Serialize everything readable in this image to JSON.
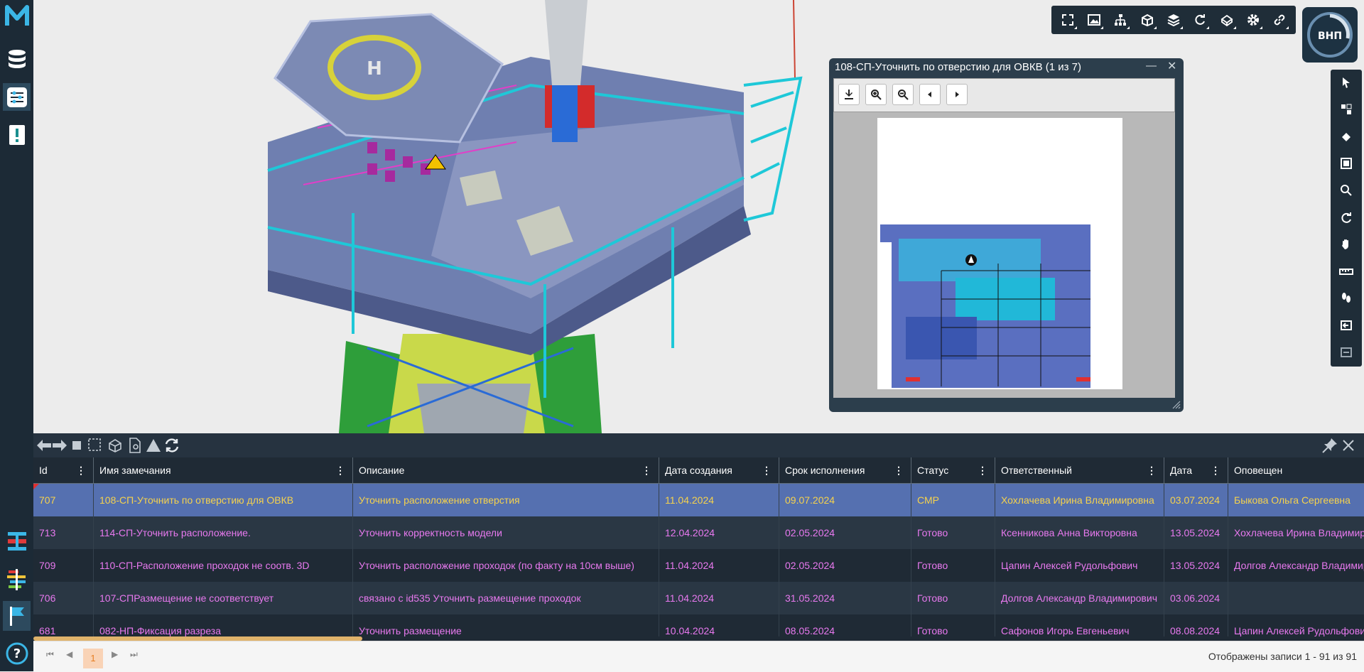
{
  "doc_window": {
    "title": "108-СП-Уточнить по отверстию для ОВКВ (1 из 7)",
    "minimize_symbol": "—",
    "close_symbol": "✕"
  },
  "logo": {
    "text": "ВНП"
  },
  "table": {
    "columns": [
      "Id",
      "Имя замечания",
      "Описание",
      "Дата создания",
      "Срок исполнения",
      "Статус",
      "Ответственный",
      "Дата",
      "Оповещен"
    ],
    "rows": [
      [
        "707",
        "108-СП-Уточнить по отверстию для ОВКВ",
        "Уточнить расположение отверстия",
        "11.04.2024",
        "09.07.2024",
        "СМР",
        "Хохлачева Ирина Владимировна",
        "03.07.2024",
        "Быкова Ольга Сергеевна"
      ],
      [
        "713",
        "114-СП-Уточнить расположение.",
        "Уточнить корректность модели",
        "12.04.2024",
        "02.05.2024",
        "Готово",
        "Ксенникова Анна Викторовна",
        "13.05.2024",
        "Хохлачева Ирина Владимировна"
      ],
      [
        "709",
        "110-СП-Расположение проходок не соотв. 3D",
        "Уточнить расположение проходок (по факту на 10см выше)",
        "11.04.2024",
        "02.05.2024",
        "Готово",
        "Цапин Алексей Рудольфович",
        "13.05.2024",
        "Долгов Александр Владимирович"
      ],
      [
        "706",
        "107-СПРазмещение не соответствует",
        "связано с id535 Уточнить размещение проходок",
        "11.04.2024",
        "31.05.2024",
        "Готово",
        "Долгов Александр Владимирович",
        "03.06.2024",
        ""
      ],
      [
        "681",
        "082-НП-Фиксация разреза",
        "Уточнить размещение",
        "10.04.2024",
        "08.05.2024",
        "Готово",
        "Сафонов Игорь Евгеньевич",
        "08.08.2024",
        "Цапин Алексей Рудольфович"
      ]
    ],
    "selected_row_index": 0,
    "column_menu_symbol": "⋮"
  },
  "pager": {
    "current_page": "1",
    "info": "Отображены записи 1 - 91 из 91",
    "first_symbol": "⏮",
    "prev_symbol": "◀",
    "next_symbol": "▶",
    "last_symbol": "⏭"
  },
  "colors": {
    "sidebar": "#1c2a36",
    "toolbar": "#1f2d38",
    "table_bg": "#1f2a35",
    "row_alt": "#2a3744",
    "selected_row": "#5570b0",
    "cell_text": "#e879ef",
    "selected_text": "#f6d24c",
    "pager_active": "#f9d3b6"
  },
  "icons": {
    "left_bar": [
      "app-logo-icon",
      "database-icon",
      "filter-settings-icon",
      "issue-report-icon",
      "pipeline-icon",
      "gantt-icon",
      "flag-icon",
      "help-icon"
    ],
    "top_toolbar": [
      "fullscreen-icon",
      "image-icon",
      "hierarchy-icon",
      "cube-icon",
      "layers-icon",
      "rotate-icon",
      "model-icon",
      "gear-icon",
      "link-icon"
    ],
    "right_toolbar": [
      "select-cursor-icon",
      "section-icon",
      "isolate-icon",
      "fit-view-icon",
      "zoom-icon",
      "orbit-icon",
      "pan-hand-icon",
      "measure-icon",
      "walk-icon",
      "back-icon",
      "collapse-icon"
    ],
    "panel_toolbar": [
      "arrow-left-icon",
      "arrow-right-icon",
      "select-box-icon",
      "select-area-icon",
      "model-select-icon",
      "document-icon",
      "warning-icon",
      "refresh-icon",
      "pin-icon",
      "close-icon"
    ]
  }
}
